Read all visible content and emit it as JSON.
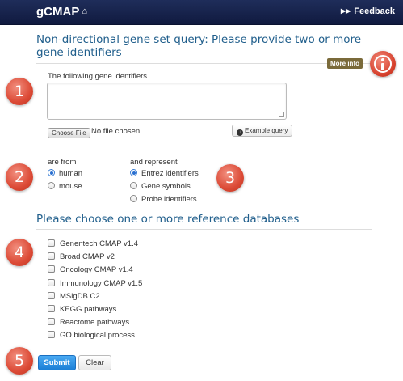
{
  "navbar": {
    "brand": "gCMAP",
    "home_icon": "home-icon",
    "feedback_label": "Feedback",
    "feedback_icon": "fast-forward-icon"
  },
  "query": {
    "title": "Non-directional gene set query: Please provide two or more gene identifiers",
    "more_info_label": "More info",
    "gene_ids_label": "The following gene identifiers",
    "textarea_value": "",
    "choose_file_label": "Choose File",
    "no_file_text": "No file chosen",
    "example_query_label": "Example query"
  },
  "species": {
    "label": "are from",
    "options": [
      {
        "label": "human",
        "selected": true
      },
      {
        "label": "mouse",
        "selected": false
      }
    ]
  },
  "identifier_type": {
    "label": "and represent",
    "options": [
      {
        "label": "Entrez identifiers",
        "selected": true
      },
      {
        "label": "Gene symbols",
        "selected": false
      },
      {
        "label": "Probe identifiers",
        "selected": false
      }
    ]
  },
  "reference": {
    "title": "Please choose one or more reference databases",
    "databases": [
      {
        "label": "Genentech CMAP v1.4",
        "checked": false
      },
      {
        "label": "Broad CMAP v2",
        "checked": false
      },
      {
        "label": "Oncology CMAP v1.4",
        "checked": false
      },
      {
        "label": "Immunology CMAP v1.5",
        "checked": false
      },
      {
        "label": "MSigDB C2",
        "checked": false
      },
      {
        "label": "KEGG pathways",
        "checked": false
      },
      {
        "label": "Reactome pathways",
        "checked": false
      },
      {
        "label": "GO biological process",
        "checked": false
      }
    ]
  },
  "actions": {
    "submit_label": "Submit",
    "clear_label": "Clear"
  },
  "steps": [
    "1",
    "2",
    "3",
    "4",
    "5"
  ],
  "colors": {
    "navbar": "#1a2550",
    "heading": "#215f8c",
    "step_badge": "#dc4a36",
    "submit": "#2a8be0",
    "more_info_badge": "#7a6a3a"
  }
}
